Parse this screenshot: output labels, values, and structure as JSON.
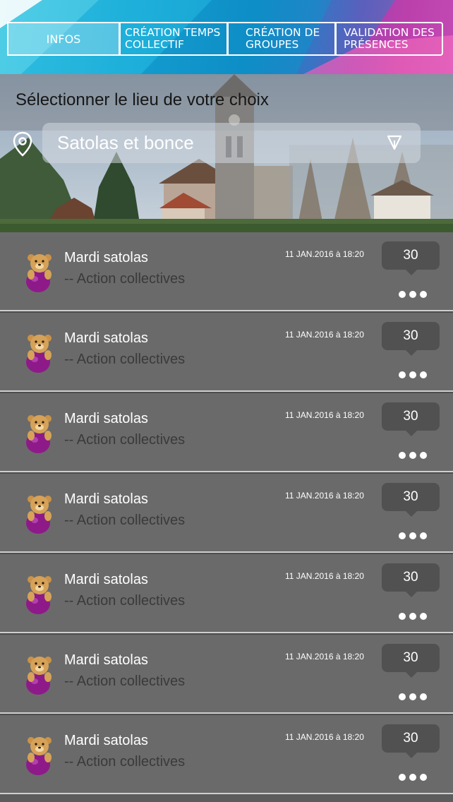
{
  "tabs": [
    {
      "label": "INFOS",
      "active": true
    },
    {
      "label": "CRÉATION TEMPS COLLECTIF",
      "active": false
    },
    {
      "label": "CRÉATION DE GROUPES",
      "active": false
    },
    {
      "label": "VALIDATION DES PRÉSENCES",
      "active": false
    }
  ],
  "location": {
    "title": "Sélectionner le lieu de votre choix",
    "selected": "Satolas et bonce",
    "icon": "map-pin-icon",
    "arrow_icon": "dropdown-arrow-icon"
  },
  "items": [
    {
      "title": "Mardi satolas",
      "subtitle": "-- Action collectives",
      "date": "11 JAN.2016 à 18:20",
      "count": "30"
    },
    {
      "title": "Mardi satolas",
      "subtitle": "-- Action collectives",
      "date": "11 JAN.2016 à 18:20",
      "count": "30"
    },
    {
      "title": "Mardi satolas",
      "subtitle": "-- Action collectives",
      "date": "11 JAN.2016 à 18:20",
      "count": "30"
    },
    {
      "title": "Mardi satolas",
      "subtitle": "-- Action collectives",
      "date": "11 JAN.2016 à 18:20",
      "count": "30"
    },
    {
      "title": "Mardi satolas",
      "subtitle": "-- Action collectives",
      "date": "11 JAN.2016 à 18:20",
      "count": "30"
    },
    {
      "title": "Mardi satolas",
      "subtitle": "-- Action collectives",
      "date": "11 JAN.2016 à 18:20",
      "count": "30"
    },
    {
      "title": "Mardi satolas",
      "subtitle": "-- Action collectives",
      "date": "11 JAN.2016 à 18:20",
      "count": "30"
    }
  ],
  "colors": {
    "accent_blue": "#1aa9d6",
    "accent_pink": "#d24ba8",
    "list_bg": "#6b6a6a",
    "bubble_bg": "#525151"
  }
}
